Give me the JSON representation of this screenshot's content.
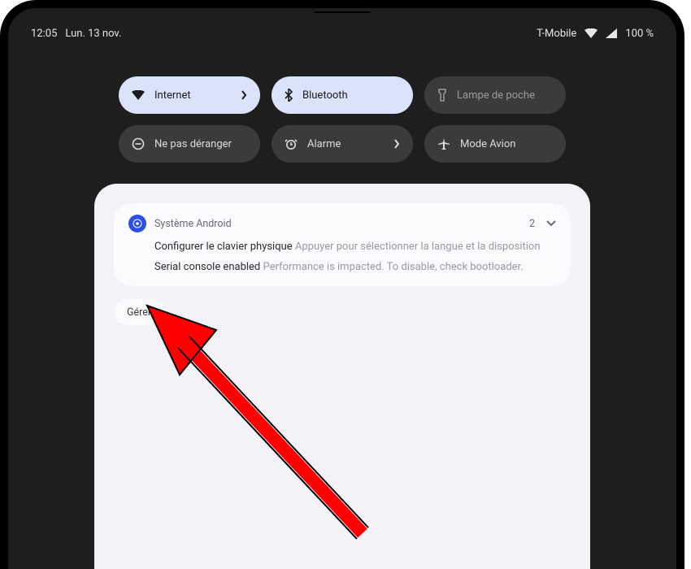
{
  "status": {
    "time": "12:05",
    "date": "Lun. 13 nov.",
    "carrier": "T-Mobile",
    "battery": "100 %"
  },
  "tiles": {
    "internet": "Internet",
    "bluetooth": "Bluetooth",
    "flashlight": "Lampe de poche",
    "dnd": "Ne pas déranger",
    "alarm": "Alarme",
    "airplane": "Mode Avion"
  },
  "notification": {
    "app": "Système Android",
    "count": "2",
    "line1_title": "Configurer le clavier physique",
    "line1_body": "Appuyer pour sélectionner la langue et la disposition",
    "line2_title": "Serial console enabled",
    "line2_body": "Performance is impacted. To disable, check bootloader."
  },
  "manage_label": "Gérer"
}
